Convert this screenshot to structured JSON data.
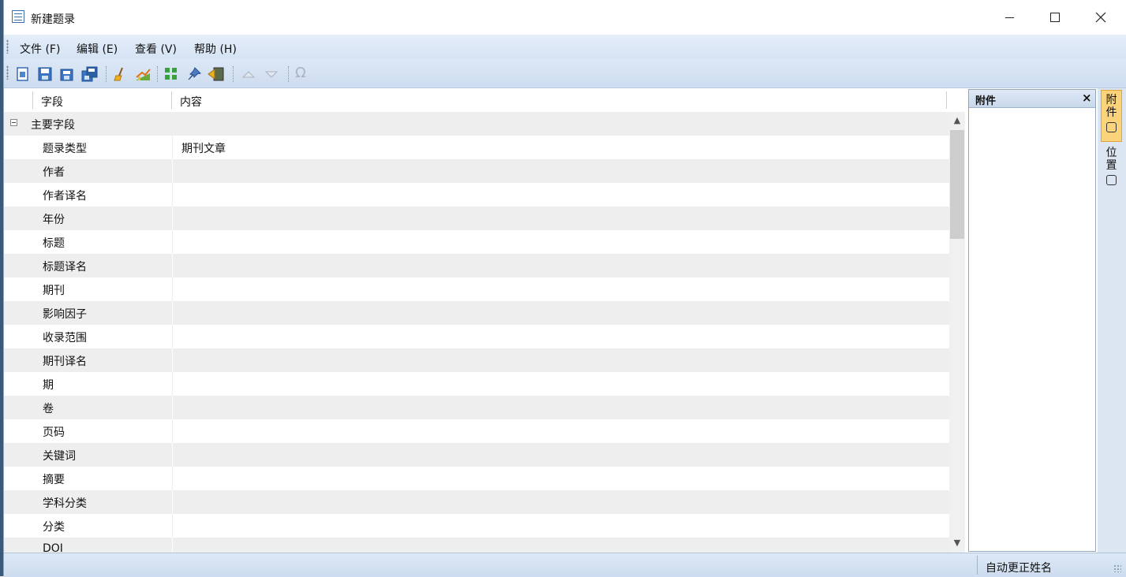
{
  "window": {
    "title": "新建题录",
    "icon": "list-icon",
    "controls": [
      "minimize-icon",
      "maximize-icon",
      "close-icon"
    ]
  },
  "menu": [
    {
      "label": "文件 (F)"
    },
    {
      "label": "编辑 (E)"
    },
    {
      "label": "查看 (V)"
    },
    {
      "label": "帮助 (H)"
    }
  ],
  "toolbar": {
    "omega_glyph": "Ω",
    "icons": [
      "new-icon",
      "save-icon",
      "save-close-icon",
      "save-all-icon",
      "clear-icon",
      "chart-icon",
      "grid-icon",
      "pin-icon",
      "export-icon",
      "up-arrow-icon",
      "down-arrow-icon",
      "omega-icon"
    ]
  },
  "grid": {
    "headers": {
      "field": "字段",
      "content": "内容"
    },
    "group": {
      "label": "主要字段",
      "expanded": true
    },
    "rows": [
      {
        "field": "题录类型",
        "value": "期刊文章"
      },
      {
        "field": "作者",
        "value": ""
      },
      {
        "field": "作者译名",
        "value": ""
      },
      {
        "field": "年份",
        "value": ""
      },
      {
        "field": "标题",
        "value": ""
      },
      {
        "field": "标题译名",
        "value": ""
      },
      {
        "field": "期刊",
        "value": ""
      },
      {
        "field": "影响因子",
        "value": ""
      },
      {
        "field": "收录范围",
        "value": ""
      },
      {
        "field": "期刊译名",
        "value": ""
      },
      {
        "field": "期",
        "value": ""
      },
      {
        "field": "卷",
        "value": ""
      },
      {
        "field": "页码",
        "value": ""
      },
      {
        "field": "关键词",
        "value": ""
      },
      {
        "field": "摘要",
        "value": ""
      },
      {
        "field": "学科分类",
        "value": ""
      },
      {
        "field": "分类",
        "value": ""
      },
      {
        "field": "DOI",
        "value": ""
      }
    ]
  },
  "attachments_panel": {
    "title": "附件",
    "close_glyph": "×"
  },
  "side_tabs": {
    "attachments": {
      "char1": "附",
      "char2": "件"
    },
    "location": {
      "char1": "位",
      "char2": "置"
    }
  },
  "status": {
    "text": "自动更正姓名"
  },
  "colors": {
    "accent_tab": "#fbd37a",
    "toolbar_bg": "#d5e3f4",
    "row_alt": "#eeeeee"
  }
}
